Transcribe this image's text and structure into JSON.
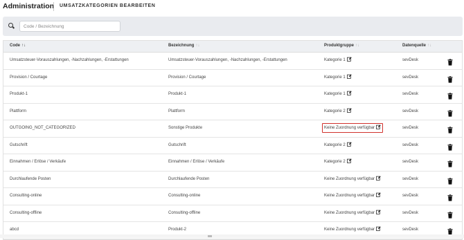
{
  "header": {
    "app_title": "Administration",
    "page_title": "UMSATZKATEGORIEN BEARBEITEN"
  },
  "search": {
    "placeholder": "Code / Bezeichnung",
    "value": ""
  },
  "table": {
    "columns": {
      "code": "Code",
      "bezeichnung": "Bezeichnung",
      "produktgruppe": "Produktgruppe",
      "datenquelle": "Datenquelle"
    },
    "rows": [
      {
        "code": "Umsatzsteuer-Vorauszahlungen, -Nachzahlungen, -Erstattungen",
        "bezeichnung": "Umsatzsteuer-Vorauszahlungen, -Nachzahlungen, -Erstattungen",
        "produktgruppe": "Kategorie 1",
        "datenquelle": "sevDesk"
      },
      {
        "code": "Provision / Courtage",
        "bezeichnung": "Provision / Courtage",
        "produktgruppe": "Kategorie 1",
        "datenquelle": "sevDesk"
      },
      {
        "code": "Produkt-1",
        "bezeichnung": "Produkt-1",
        "produktgruppe": "Kategorie 1",
        "datenquelle": "sevDesk"
      },
      {
        "code": "Plattform",
        "bezeichnung": "Plattform",
        "produktgruppe": "Kategorie 2",
        "datenquelle": "sevDesk"
      },
      {
        "code": "OUTGOING_NOT_CATEGORIZED",
        "bezeichnung": "Sonstige Produkte",
        "produktgruppe": "Keine Zuordnung verfügbar",
        "datenquelle": "sevDesk",
        "highlighted": true
      },
      {
        "code": "Gutschrift",
        "bezeichnung": "Gutschrift",
        "produktgruppe": "Kategorie 2",
        "datenquelle": "sevDesk"
      },
      {
        "code": "Einnahmen / Erlöse / Verkäufe",
        "bezeichnung": "Einnahmen / Erlöse / Verkäufe",
        "produktgruppe": "Kategorie 2",
        "datenquelle": "sevDesk"
      },
      {
        "code": "Durchlaufende Posten",
        "bezeichnung": "Durchlaufende Posten",
        "produktgruppe": "Keine Zuordnung verfügbar",
        "datenquelle": "sevDesk"
      },
      {
        "code": "Consulting-online",
        "bezeichnung": "Consulting-online",
        "produktgruppe": "Keine Zuordnung verfügbar",
        "datenquelle": "sevDesk"
      },
      {
        "code": "Consulting-offline",
        "bezeichnung": "Consulting-offline",
        "produktgruppe": "Keine Zuordnung verfügbar",
        "datenquelle": "sevDesk"
      },
      {
        "code": "abcd",
        "bezeichnung": "Produkt-2",
        "produktgruppe": "Keine Zuordnung verfügbar",
        "datenquelle": "sevDesk"
      }
    ]
  },
  "icons": {
    "search": "search-icon",
    "edit": "edit-icon",
    "delete": "trash-icon",
    "sort_asc": "sort-ascending-icon",
    "sort": "sort-icon"
  },
  "colors": {
    "highlight_border": "#d0302b",
    "search_panel_bg": "#e9ebef",
    "header_bg": "#eef0f3"
  }
}
